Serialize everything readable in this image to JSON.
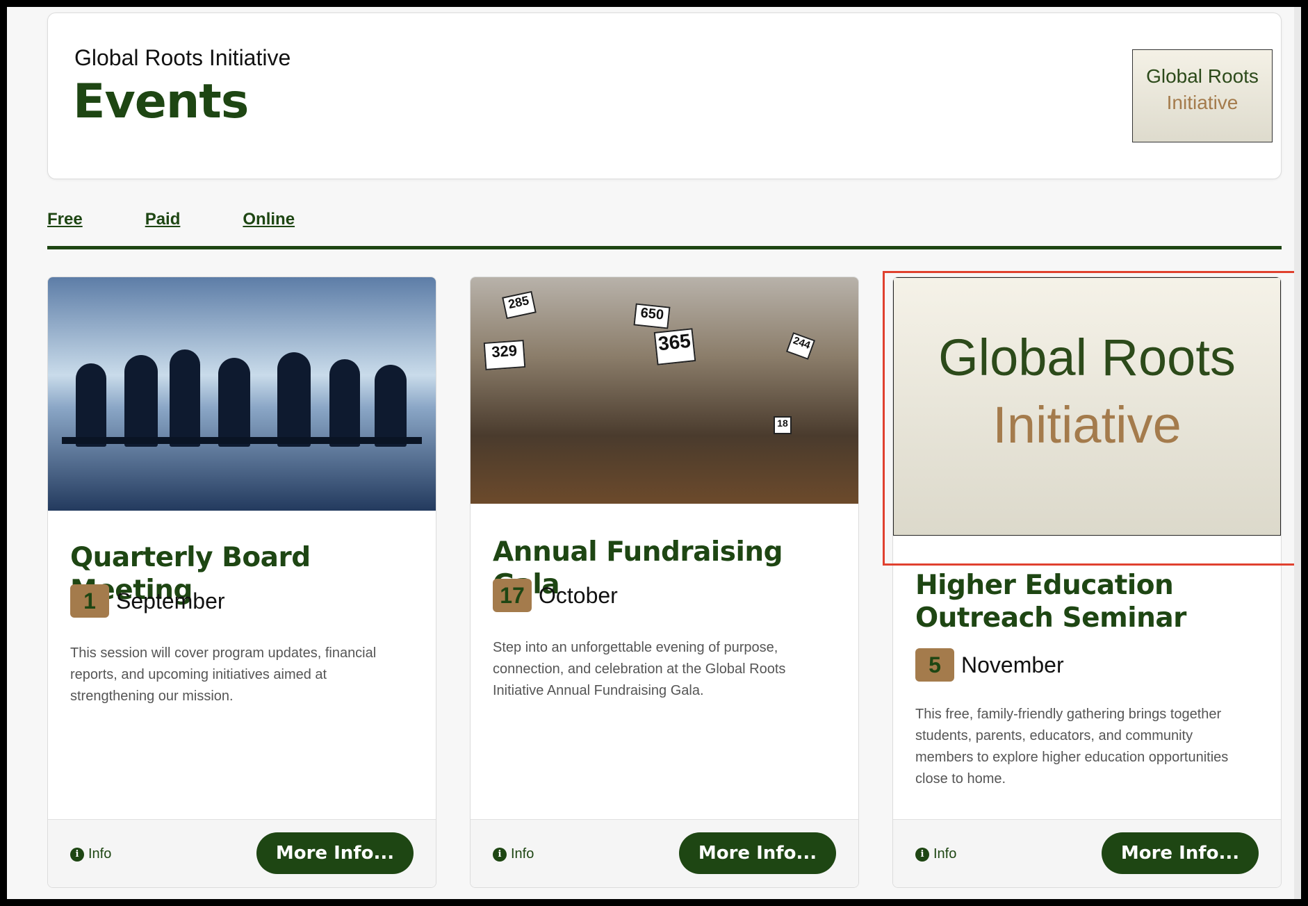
{
  "header": {
    "org_name": "Global Roots Initiative",
    "page_title": "Events",
    "logo_line1": "Global Roots",
    "logo_line2": "Initiative"
  },
  "tabs": [
    {
      "label": "Free"
    },
    {
      "label": "Paid"
    },
    {
      "label": "Online"
    }
  ],
  "events": [
    {
      "title": "Quarterly Board Meeting",
      "day": "1",
      "month": "September",
      "description": "This session will cover program updates, financial reports, and upcoming initiatives aimed at strengthening our mission.",
      "info_label": "Info",
      "button_label": "More Info..."
    },
    {
      "title": "Annual Fundraising Gala",
      "day": "17",
      "month": "October",
      "description": "Step into an unforgettable evening of purpose, connection, and celebration at the Global Roots Initiative Annual Fundraising Gala.",
      "info_label": "Info",
      "button_label": "More Info...",
      "paddle_numbers": [
        "285",
        "650",
        "329",
        "365",
        "244",
        "18"
      ]
    },
    {
      "title": "Higher Education Outreach Seminar",
      "day": "5",
      "month": "November",
      "description": "This free, family-friendly gathering brings together students, parents, educators, and community members to explore higher education opportunities close to home.",
      "info_label": "Info",
      "button_label": "More Info...",
      "image_logo_line1": "Global Roots",
      "image_logo_line2": "Initiative"
    }
  ],
  "colors": {
    "brand_green": "#1e4613",
    "accent_tan": "#a47b4c",
    "highlight_red": "#e0412f"
  }
}
